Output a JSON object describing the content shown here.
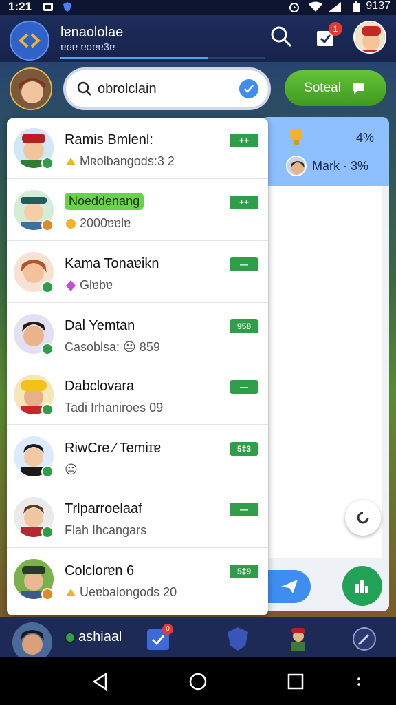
{
  "status_bar": {
    "time": "1:21",
    "battery_text": "9137"
  },
  "header": {
    "title": "lɐnaololae",
    "subtitle": "ɐɐɐ ɐoɐɐ3ɐ",
    "progress": 0.72,
    "cart_badge": "1"
  },
  "search": {
    "value": "obrolclain"
  },
  "send_button": {
    "label": "Soteal"
  },
  "right_panel": {
    "top_percent": "4%",
    "mark_label": "Mark · 3%"
  },
  "friends": [
    {
      "name": "Ramis Bmlenl:",
      "sub": "Mʀolbangods:3 2",
      "pill": "++",
      "highlight": false
    },
    {
      "name": "Noeddenang",
      "sub": "2000ɐɐlɐ",
      "pill": "++",
      "highlight": true
    },
    {
      "name": "Kama Tonaɐikn",
      "sub": "Glɐbɐ",
      "pill": "—",
      "highlight": false
    },
    {
      "name": "Dal Yemtan",
      "sub": "Casoblsa: 😐 859",
      "pill": "958",
      "highlight": false
    },
    {
      "name": "Dabclovara",
      "sub": "Tadi Irhaniroes 09",
      "pill": "—",
      "highlight": false
    },
    {
      "name": "RiwCre ⁄ Temiɪɐ",
      "sub": "😐",
      "pill": "5‡3",
      "highlight": false
    },
    {
      "name": "Trlparroelaaf",
      "sub": "Flah Ihcangars",
      "pill": "—",
      "highlight": false
    },
    {
      "name": "Colclorɐn 6",
      "sub": "Ueɐbalongods 20",
      "pill": "5‡9",
      "highlight": false
    }
  ],
  "bottom_nav": {
    "name": "ashiaal",
    "badge": "0"
  },
  "colors": {
    "accent_green": "#2e9e48",
    "accent_blue": "#3d8ef0",
    "header_bg": "#1d2d5c"
  }
}
